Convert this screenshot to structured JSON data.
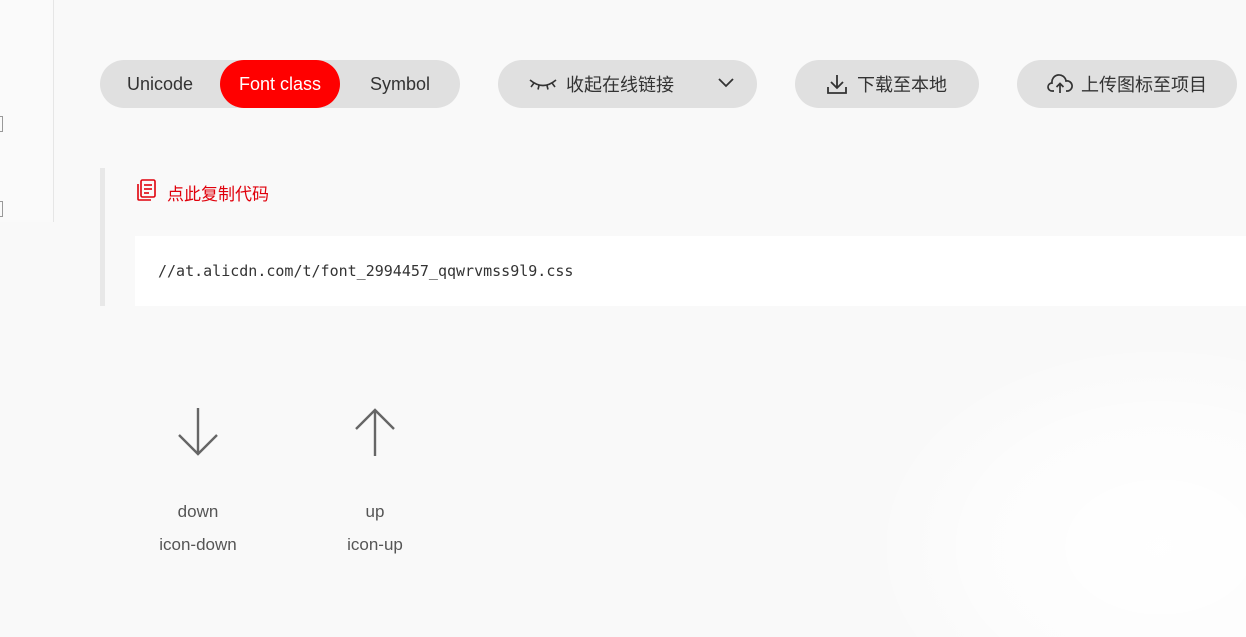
{
  "tabs": [
    {
      "label": "Unicode",
      "active": false
    },
    {
      "label": "Font class",
      "active": true
    },
    {
      "label": "Symbol",
      "active": false
    }
  ],
  "actions": {
    "collapse_label": "收起在线链接",
    "download_label": "下载至本地",
    "upload_label": "上传图标至项目"
  },
  "code": {
    "copy_label": "点此复制代码",
    "url": "//at.alicdn.com/t/font_2994457_qqwrvmss9l9.css"
  },
  "icons": [
    {
      "name": "down",
      "class": "icon-down",
      "icon": "arrow-down-icon"
    },
    {
      "name": "up",
      "class": "icon-up",
      "icon": "arrow-up-icon"
    }
  ],
  "colors": {
    "accent": "#ff0000",
    "link": "#e0000b",
    "pill_bg": "#e0e0e0",
    "page_bg": "#f9f9f9"
  }
}
